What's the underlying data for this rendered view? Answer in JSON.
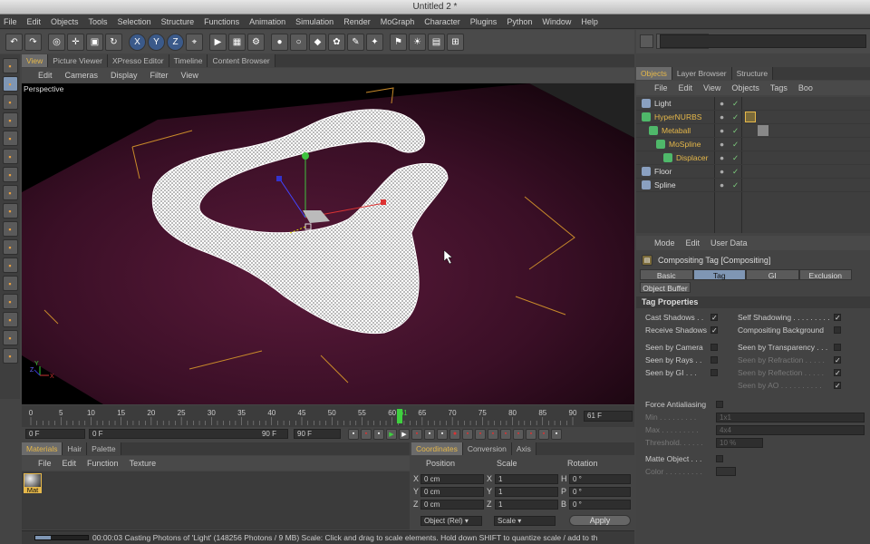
{
  "window_title": "Untitled 2 *",
  "menu": [
    "File",
    "Edit",
    "Objects",
    "Tools",
    "Selection",
    "Structure",
    "Functions",
    "Animation",
    "Simulation",
    "Render",
    "MoGraph",
    "Character",
    "Plugins",
    "Python",
    "Window",
    "Help"
  ],
  "toolbar_icons": [
    "undo-icon",
    "redo-icon",
    "live-select-icon",
    "move-icon",
    "scale-icon",
    "rotate-icon",
    "x-axis-icon",
    "y-axis-icon",
    "z-axis-icon",
    "coordinate-system-icon",
    "render-view-icon",
    "render-picture-viewer-icon",
    "edit-render-settings-icon",
    "cube-icon",
    "spline-pen-icon",
    "subdivision-surface-icon",
    "array-icon",
    "deformer-icon",
    "scene-icon",
    "camera-icon",
    "light-icon",
    "floor-icon",
    "layout-grid-icon"
  ],
  "toolbar_glyphs": {
    "x": "X",
    "y": "Y",
    "z": "Z"
  },
  "left_tools": [
    "make-editable-icon",
    "model-mode-icon",
    "texture-mode-icon",
    "axis-mode-icon",
    "points-mode-icon",
    "edges-mode-icon",
    "polygons-mode-icon",
    "checker-icon",
    "uv-points-icon",
    "uv-polygons-icon",
    "snapping-icon",
    "workplane-icon",
    "axis-lock-icon",
    "paint-icon",
    "magnet-icon",
    "brush-icon",
    "knife-icon"
  ],
  "viewport": {
    "tabs": [
      "View",
      "Picture Viewer",
      "XPresso Editor",
      "Timeline",
      "Content Browser"
    ],
    "active_tab": "View",
    "menu": [
      "Edit",
      "Cameras",
      "Display",
      "Filter",
      "View"
    ],
    "label": "Perspective",
    "axis_labels": {
      "x": "X",
      "y": "Y",
      "z": "Z"
    }
  },
  "timeline": {
    "ticks": [
      "0",
      "5",
      "10",
      "15",
      "20",
      "25",
      "30",
      "35",
      "40",
      "45",
      "50",
      "55",
      "60",
      "61",
      "65",
      "70",
      "75",
      "80",
      "85",
      "90"
    ],
    "current_frame": "61 F",
    "range_start": "0 F",
    "range_field": "0 F",
    "range_end": "90 F",
    "end_field": "90 F"
  },
  "materials": {
    "tabs": [
      "Materials",
      "Hair",
      "Palette"
    ],
    "menu": [
      "File",
      "Edit",
      "Function",
      "Texture"
    ],
    "items": [
      {
        "name": "Mat"
      }
    ]
  },
  "coordinates": {
    "tabs": [
      "Coordinates",
      "Conversion",
      "Axis"
    ],
    "headers": [
      "Position",
      "Scale",
      "Rotation"
    ],
    "rows": [
      {
        "axis": "X",
        "pos": "0 cm",
        "scale_axis": "X",
        "scale": "1",
        "rot_axis": "H",
        "rot": "0 °"
      },
      {
        "axis": "Y",
        "pos": "0 cm",
        "scale_axis": "Y",
        "scale": "1",
        "rot_axis": "P",
        "rot": "0 °"
      },
      {
        "axis": "Z",
        "pos": "0 cm",
        "scale_axis": "Z",
        "scale": "1",
        "rot_axis": "B",
        "rot": "0 °"
      }
    ],
    "mode_select": "Object (Rel)",
    "scale_select": "Scale",
    "apply_label": "Apply"
  },
  "status": {
    "text": "00:00:03 Casting Photons of 'Light' (148256 Photons / 9 MB)  Scale: Click and drag to scale elements. Hold down SHIFT to quantize scale / add to th",
    "progress": 0.3
  },
  "objects_panel": {
    "tabs": [
      "Objects",
      "Layer Browser",
      "Structure"
    ],
    "menu": [
      "File",
      "Edit",
      "View",
      "Objects",
      "Tags",
      "Boo"
    ],
    "objects": [
      {
        "name": "Light",
        "indent": 0,
        "highlight": false
      },
      {
        "name": "HyperNURBS",
        "indent": 0,
        "highlight": true
      },
      {
        "name": "Metaball",
        "indent": 1,
        "highlight": true
      },
      {
        "name": "MoSpline",
        "indent": 2,
        "highlight": true
      },
      {
        "name": "Displacer",
        "indent": 3,
        "highlight": true
      },
      {
        "name": "Floor",
        "indent": 0,
        "highlight": false
      },
      {
        "name": "Spline",
        "indent": 0,
        "highlight": false
      }
    ]
  },
  "attributes": {
    "menu": [
      "Mode",
      "Edit",
      "User Data"
    ],
    "title": "Compositing Tag [Compositing]",
    "tabs": [
      "Basic",
      "Tag",
      "GI",
      "Exclusion"
    ],
    "tab2": "Object Buffer",
    "active_tab": "Tag",
    "section": "Tag Properties",
    "props_left": [
      {
        "label": "Cast Shadows . .",
        "checked": true,
        "dim": false
      },
      {
        "label": "Receive Shadows",
        "checked": true,
        "dim": false
      },
      {
        "label": "Seen by Camera",
        "checked": false,
        "dim": false
      },
      {
        "label": "Seen by Rays . .",
        "checked": false,
        "dim": false
      },
      {
        "label": "Seen by GI . . .",
        "checked": false,
        "dim": false
      }
    ],
    "props_right": [
      {
        "label": "Self Shadowing . . . . . . . . .",
        "checked": true,
        "dim": false
      },
      {
        "label": "Compositing Background",
        "checked": false,
        "dim": false
      },
      {
        "label": "Seen by Transparency . . .",
        "checked": false,
        "dim": false
      },
      {
        "label": "Seen by Refraction . . . . .",
        "checked": true,
        "dim": true
      },
      {
        "label": "Seen by Reflection . . . . .",
        "checked": true,
        "dim": true
      },
      {
        "label": "Seen by AO . . . . . . . . . .",
        "checked": true,
        "dim": true
      }
    ],
    "force_aa": "Force Antialiasing",
    "min_label": "Min . . . . . . . . .",
    "min_value": "1x1",
    "max_label": "Max . . . . . . . . .",
    "max_value": "4x4",
    "threshold_label": "Threshold. . . . . .",
    "threshold_value": "10 %",
    "matte": "Matte Object . . .",
    "color_label": "Color . . . . . . . . ."
  },
  "colors": {
    "accent": "#e6b84a",
    "floor": "#3a0f26",
    "selected_tab": "#7f96b4"
  }
}
